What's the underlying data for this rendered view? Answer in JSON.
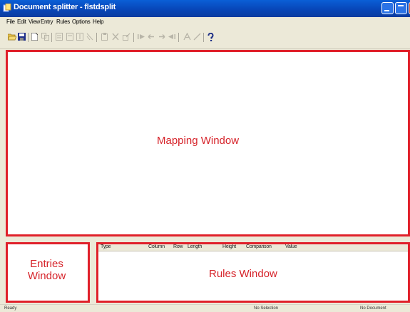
{
  "window": {
    "title": "Document splitter - flstdsplit"
  },
  "menu": [
    "File",
    "Edit",
    "View",
    "Entry",
    "Rules",
    "Options",
    "Help"
  ],
  "toolbar": {
    "icons": [
      "open-icon",
      "save-icon",
      "new-icon",
      "copy-icon",
      "page-icon",
      "page-icon",
      "page-icon",
      "page-icon",
      "paste-icon",
      "delete-icon",
      "edit-icon",
      "first-icon",
      "prev-icon",
      "next-icon",
      "last-icon",
      "text-tool-icon",
      "line-tool-icon",
      "help-icon"
    ]
  },
  "mapping_window": {
    "label": "Mapping Window"
  },
  "entries_window": {
    "label_line1": "Entries",
    "label_line2": "Window"
  },
  "rules_window": {
    "label": "Rules Window",
    "columns": [
      "Type",
      "Column",
      "Row",
      "Length",
      "Height",
      "Comparison",
      "Value"
    ]
  },
  "status": {
    "left": "Ready",
    "middle": "No Selection",
    "right": "No Document"
  },
  "colors": {
    "annotation": "#e0202a",
    "titlebar": "#0846b8",
    "chrome": "#ece9d8"
  }
}
